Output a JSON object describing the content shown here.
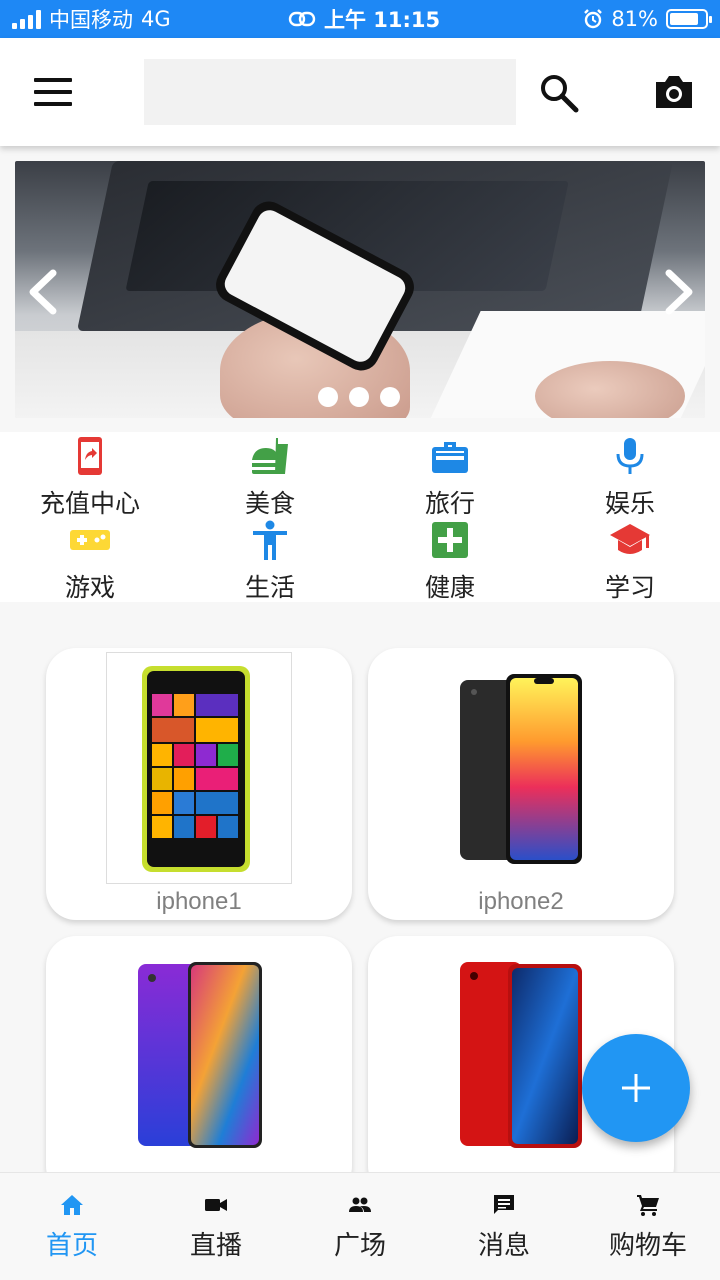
{
  "status_bar": {
    "carrier": "中国移动",
    "network": "4G",
    "time": "上午 11:15",
    "battery": "81%",
    "battery_level": 0.81
  },
  "app_bar": {
    "search_placeholder": "",
    "icons": [
      "menu-icon",
      "search-icon",
      "camera-icon"
    ]
  },
  "banner": {
    "slide_count": 3,
    "active_index": 0
  },
  "categories": [
    {
      "label": "充值中心",
      "icon": "phone-recharge-icon",
      "color": "#e53935"
    },
    {
      "label": "美食",
      "icon": "fastfood-icon",
      "color": "#43a047"
    },
    {
      "label": "旅行",
      "icon": "work-bag-icon",
      "color": "#1e88e5"
    },
    {
      "label": "娱乐",
      "icon": "mic-icon",
      "color": "#1e88e5"
    },
    {
      "label": "游戏",
      "icon": "gamepad-icon",
      "color": "#fdd835"
    },
    {
      "label": "生活",
      "icon": "person-icon",
      "color": "#1e88e5"
    },
    {
      "label": "健康",
      "icon": "health-cross-icon",
      "color": "#43a047"
    },
    {
      "label": "学习",
      "icon": "school-icon",
      "color": "#e53935"
    }
  ],
  "products": [
    {
      "name": "iphone1"
    },
    {
      "name": "iphone2"
    },
    {
      "name": ""
    },
    {
      "name": ""
    }
  ],
  "fab": {
    "icon": "add-icon",
    "color": "#2196f3"
  },
  "bottom_nav": [
    {
      "label": "首页",
      "icon": "home-icon",
      "active": true
    },
    {
      "label": "直播",
      "icon": "videocam-icon",
      "active": false
    },
    {
      "label": "广场",
      "icon": "people-icon",
      "active": false
    },
    {
      "label": "消息",
      "icon": "message-icon",
      "active": false
    },
    {
      "label": "购物车",
      "icon": "cart-icon",
      "active": false
    }
  ],
  "colors": {
    "accent": "#2196f3",
    "status_bar": "#1e88f5"
  }
}
